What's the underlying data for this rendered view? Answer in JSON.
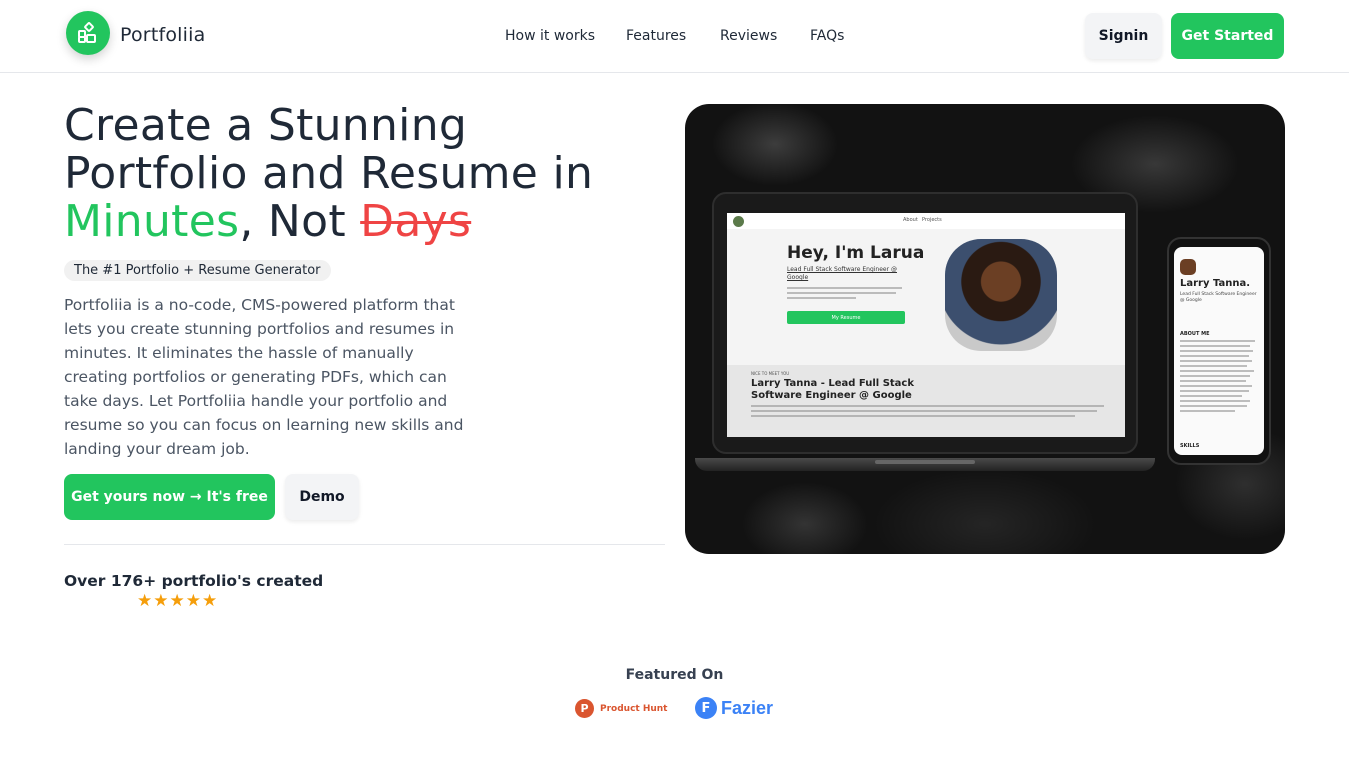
{
  "header": {
    "brand": "Portfoliia",
    "nav": [
      "How it works",
      "Features",
      "Reviews",
      "FAQs"
    ],
    "signin_label": "Signin",
    "get_started_label": "Get Started"
  },
  "hero": {
    "title_line1": "Create a Stunning",
    "title_line2": "Portfolio and Resume in",
    "title_green": "Minutes",
    "title_mid": ", Not ",
    "title_red": "Days",
    "tag": "The #1 Portfolio + Resume Generator",
    "description": "Portfoliia is a no-code, CMS-powered platform that lets you create stunning portfolios and resumes in minutes. It eliminates the hassle of manually creating portfolios or generating PDFs, which can take days. Let Portfoliia handle your portfolio and resume so you can focus on learning new skills and landing your dream job.",
    "primary_cta": "Get yours now → It's free",
    "demo_label": "Demo",
    "count_text": "Over 176+ portfolio's created",
    "rating": 5
  },
  "showcase": {
    "laptop": {
      "nav_about": "About",
      "nav_projects": "Projects",
      "greeting": "Hey, I'm Larua",
      "role": "Lead Full Stack Software Engineer @ Google",
      "resume_button": "My Resume",
      "nice_to_meet": "NICE TO MEET YOU",
      "name_line1": "Larry Tanna - Lead Full Stack",
      "name_line2": "Software Engineer @ Google"
    },
    "phone": {
      "name": "Larry Tanna.",
      "role": "Lead Full Stack Software Engineer @ Google",
      "about": "ABOUT ME",
      "skills": "SKILLS"
    }
  },
  "featured": {
    "heading": "Featured On",
    "product_hunt": "Product Hunt",
    "product_hunt_letter": "P",
    "fazier": "Fazier",
    "fazier_letter": "F"
  },
  "colors": {
    "brand_green": "#22c55e",
    "strike_red": "#ef4444",
    "star": "#f59e0b",
    "product_hunt": "#da552f",
    "fazier": "#3b82f6"
  }
}
